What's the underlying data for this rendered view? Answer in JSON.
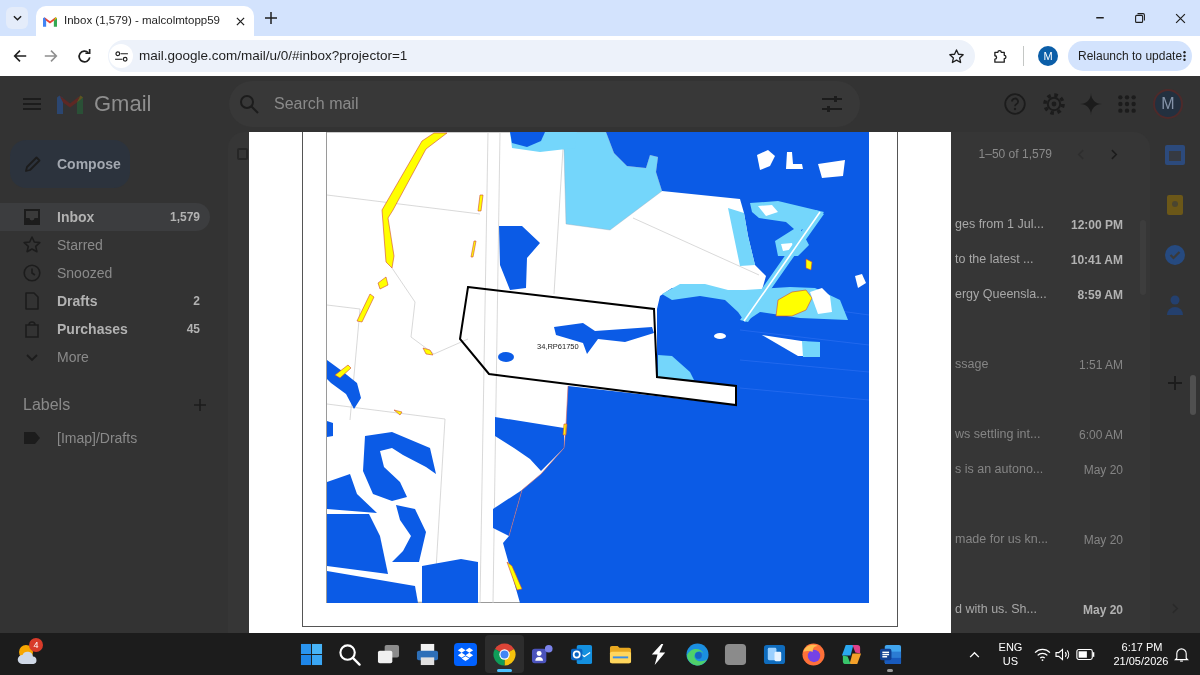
{
  "browser": {
    "tabs": [
      {
        "title": "Inbox (1,579) - malcolmtopp59",
        "selected": true
      }
    ],
    "url": "mail.google.com/mail/u/0/#inbox?projector=1",
    "profile_initial": "M",
    "update_button": "Relaunch to update"
  },
  "gmail": {
    "brand": "Gmail",
    "search": {
      "placeholder": "Search mail"
    },
    "avatar_initial": "M",
    "compose": "Compose",
    "nav": [
      {
        "kind": "inbox",
        "label": "Inbox",
        "count": "1,579",
        "selected": true,
        "unread": true
      },
      {
        "kind": "starred",
        "label": "Starred",
        "selected": false,
        "unread": false
      },
      {
        "kind": "snoozed",
        "label": "Snoozed",
        "selected": false,
        "unread": false
      },
      {
        "kind": "drafts",
        "label": "Drafts",
        "count": "2",
        "selected": false,
        "unread": true
      },
      {
        "kind": "purchases",
        "label": "Purchases",
        "count": "45",
        "selected": false,
        "unread": true
      },
      {
        "kind": "more",
        "label": "More",
        "selected": false,
        "unread": false
      }
    ],
    "labels_heading": "Labels",
    "labels": [
      {
        "name": "[Imap]/Drafts"
      }
    ],
    "select_all": {
      "checked": false
    },
    "pagination": "1–50 of 1,579",
    "emails": [
      {
        "snippet": "ges from 1 Jul...",
        "time": "12:00 PM",
        "unread": true
      },
      {
        "snippet": "to the latest ...",
        "time": "10:41 AM",
        "unread": true
      },
      {
        "snippet": "ergy Queensla...",
        "time": "8:59 AM",
        "unread": true
      },
      {
        "snippet": "ssage",
        "time": "1:51 AM",
        "unread": false
      },
      {
        "snippet": "ws settling int...",
        "time": "6:00 AM",
        "unread": false
      },
      {
        "snippet": "s is an autono...",
        "time": "May 20",
        "unread": false
      },
      {
        "snippet": "made for us kn...",
        "time": "May 20",
        "unread": false
      },
      {
        "snippet": "d with us. Sh...",
        "time": "May 20",
        "unread": true
      }
    ]
  },
  "document": {
    "parcel_label": "34,RP61750"
  },
  "taskbar": {
    "weather_badge": "4",
    "apps": [
      {
        "kind": "start",
        "selected": false,
        "running": false
      },
      {
        "kind": "search",
        "selected": false,
        "running": false
      },
      {
        "kind": "task_view",
        "selected": false,
        "running": false
      },
      {
        "kind": "printer",
        "selected": false,
        "running": false
      },
      {
        "kind": "dropbox",
        "selected": false,
        "running": false
      },
      {
        "kind": "chrome",
        "selected": true,
        "running": true
      },
      {
        "kind": "teams",
        "selected": false,
        "running": false
      },
      {
        "kind": "outlook",
        "selected": false,
        "running": false
      },
      {
        "kind": "folder",
        "selected": false,
        "running": false
      },
      {
        "kind": "lightning",
        "selected": false,
        "running": false
      },
      {
        "kind": "edge",
        "selected": false,
        "running": false
      },
      {
        "kind": "blank",
        "selected": false,
        "running": false
      },
      {
        "kind": "phone",
        "selected": false,
        "running": false
      },
      {
        "kind": "firefox",
        "selected": false,
        "running": false
      },
      {
        "kind": "ribbon",
        "selected": false,
        "running": false
      },
      {
        "kind": "word",
        "selected": false,
        "running": true
      }
    ],
    "language": "ENG",
    "region": "US",
    "time": "6:17 PM",
    "date": "21/05/2026"
  }
}
